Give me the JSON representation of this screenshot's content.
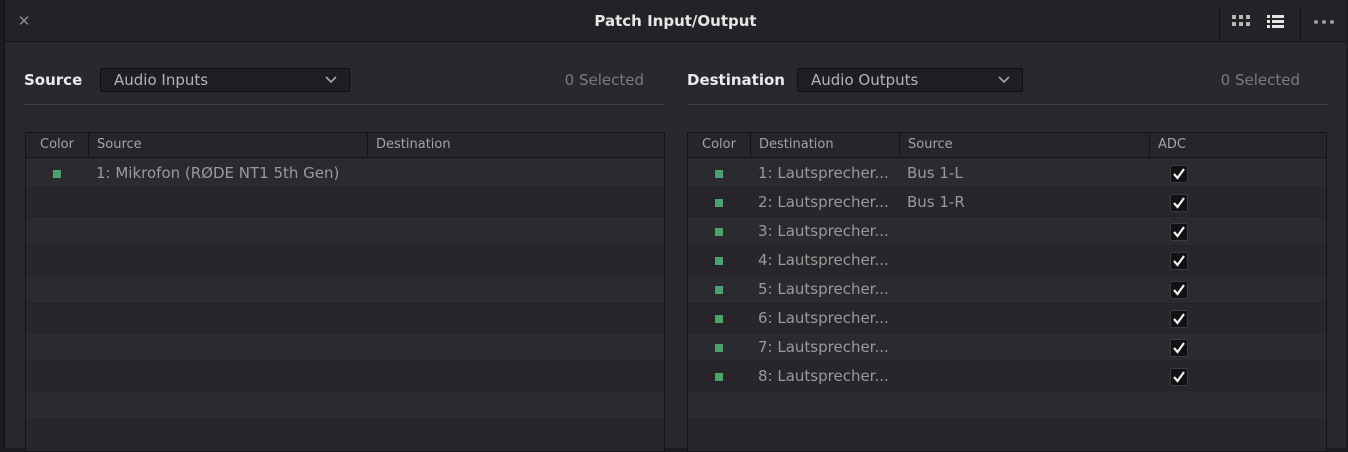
{
  "window": {
    "title": "Patch Input/Output",
    "close_glyph": "✕"
  },
  "icons": {
    "close": "close-icon",
    "grid_view": "grid-view-icon",
    "list_view": "list-view-icon",
    "more": "more-options-icon",
    "dropdown": "chevron-down-icon",
    "check": "checkmark-icon"
  },
  "colors": {
    "swatch": "#4ca16d",
    "background": "#28282e"
  },
  "source_panel": {
    "label": "Source",
    "dropdown_value": "Audio Inputs",
    "selected_count": "0 Selected",
    "columns": [
      "Color",
      "Source",
      "Destination"
    ],
    "rows": [
      {
        "source": "1: Mikrofon (RØDE NT1 5th Gen)",
        "destination": ""
      }
    ]
  },
  "destination_panel": {
    "label": "Destination",
    "dropdown_value": "Audio Outputs",
    "selected_count": "0 Selected",
    "columns": [
      "Color",
      "Destination",
      "Source",
      "ADC"
    ],
    "rows": [
      {
        "destination": "1: Lautsprecher...",
        "source": "Bus 1-L",
        "adc": true
      },
      {
        "destination": "2: Lautsprecher...",
        "source": "Bus 1-R",
        "adc": true
      },
      {
        "destination": "3: Lautsprecher...",
        "source": "",
        "adc": true
      },
      {
        "destination": "4: Lautsprecher...",
        "source": "",
        "adc": true
      },
      {
        "destination": "5: Lautsprecher...",
        "source": "",
        "adc": true
      },
      {
        "destination": "6: Lautsprecher...",
        "source": "",
        "adc": true
      },
      {
        "destination": "7: Lautsprecher...",
        "source": "",
        "adc": true
      },
      {
        "destination": "8: Lautsprecher...",
        "source": "",
        "adc": true
      }
    ]
  }
}
